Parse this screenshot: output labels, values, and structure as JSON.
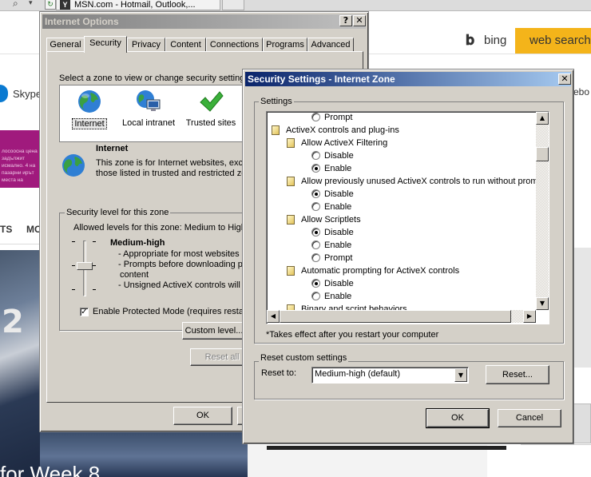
{
  "browser": {
    "tab_title": "MSN.com - Hotmail, Outlook,...",
    "bing_label": "bing",
    "web_search": "web search",
    "skype_label": "Skype",
    "ad_text": "лосоосна ценa задължит исмално. 4 на пазарни ирът места на",
    "nav_ts": "TS",
    "nav_mo": "MO",
    "photo_number": "2",
    "headline_fragment": "for Week 8",
    "right_text": "ebo"
  },
  "internet_options": {
    "title": "Internet Options",
    "help_button": "?",
    "close_button": "✕",
    "tabs": [
      "General",
      "Security",
      "Privacy",
      "Content",
      "Connections",
      "Programs",
      "Advanced"
    ],
    "active_tab": "Security",
    "zone_prompt": "Select a zone to view or change security settings.",
    "zones": [
      {
        "label": "Internet",
        "icon": "globe-icon"
      },
      {
        "label": "Local intranet",
        "icon": "intranet-icon"
      },
      {
        "label": "Trusted sites",
        "icon": "checkmark-icon"
      }
    ],
    "zone_info_title": "Internet",
    "zone_info_text": "This zone is for Internet websites, except those listed in trusted and restricted zones.",
    "security_level_label": "Security level for this zone",
    "allowed_levels": "Allowed levels for this zone: Medium to High",
    "level_title": "Medium-high",
    "level_desc": [
      "- Appropriate for most websites",
      "- Prompts before downloading po",
      "content",
      "- Unsigned ActiveX controls will n"
    ],
    "protected_mode_label": "Enable Protected Mode (requires restar",
    "protected_mode_checked": true,
    "custom_level_button": "Custom level...",
    "reset_all_button": "Reset all",
    "ok_button": "OK",
    "cancel_button": "C"
  },
  "security_settings": {
    "title": "Security Settings - Internet Zone",
    "close_button": "✕",
    "settings_label": "Settings",
    "rows": [
      {
        "type": "radio",
        "indent": 2,
        "text": "Prompt",
        "checked": false
      },
      {
        "type": "category",
        "indent": 0,
        "text": "ActiveX controls and plug-ins"
      },
      {
        "type": "setting",
        "indent": 1,
        "text": "Allow ActiveX Filtering"
      },
      {
        "type": "radio",
        "indent": 2,
        "text": "Disable",
        "checked": false
      },
      {
        "type": "radio",
        "indent": 2,
        "text": "Enable",
        "checked": true
      },
      {
        "type": "setting",
        "indent": 1,
        "text": "Allow previously unused ActiveX controls to run without prom"
      },
      {
        "type": "radio",
        "indent": 2,
        "text": "Disable",
        "checked": true
      },
      {
        "type": "radio",
        "indent": 2,
        "text": "Enable",
        "checked": false
      },
      {
        "type": "setting",
        "indent": 1,
        "text": "Allow Scriptlets"
      },
      {
        "type": "radio",
        "indent": 2,
        "text": "Disable",
        "checked": true
      },
      {
        "type": "radio",
        "indent": 2,
        "text": "Enable",
        "checked": false
      },
      {
        "type": "radio",
        "indent": 2,
        "text": "Prompt",
        "checked": false
      },
      {
        "type": "setting",
        "indent": 1,
        "text": "Automatic prompting for ActiveX controls"
      },
      {
        "type": "radio",
        "indent": 2,
        "text": "Disable",
        "checked": true
      },
      {
        "type": "radio",
        "indent": 2,
        "text": "Enable",
        "checked": false
      },
      {
        "type": "setting",
        "indent": 1,
        "text": "Binary and script behaviors"
      }
    ],
    "takes_effect_note": "*Takes effect after you restart your computer",
    "reset_custom_label": "Reset custom settings",
    "reset_to_label": "Reset to:",
    "reset_to_value": "Medium-high (default)",
    "reset_button": "Reset...",
    "ok_button": "OK",
    "cancel_button": "Cancel"
  }
}
